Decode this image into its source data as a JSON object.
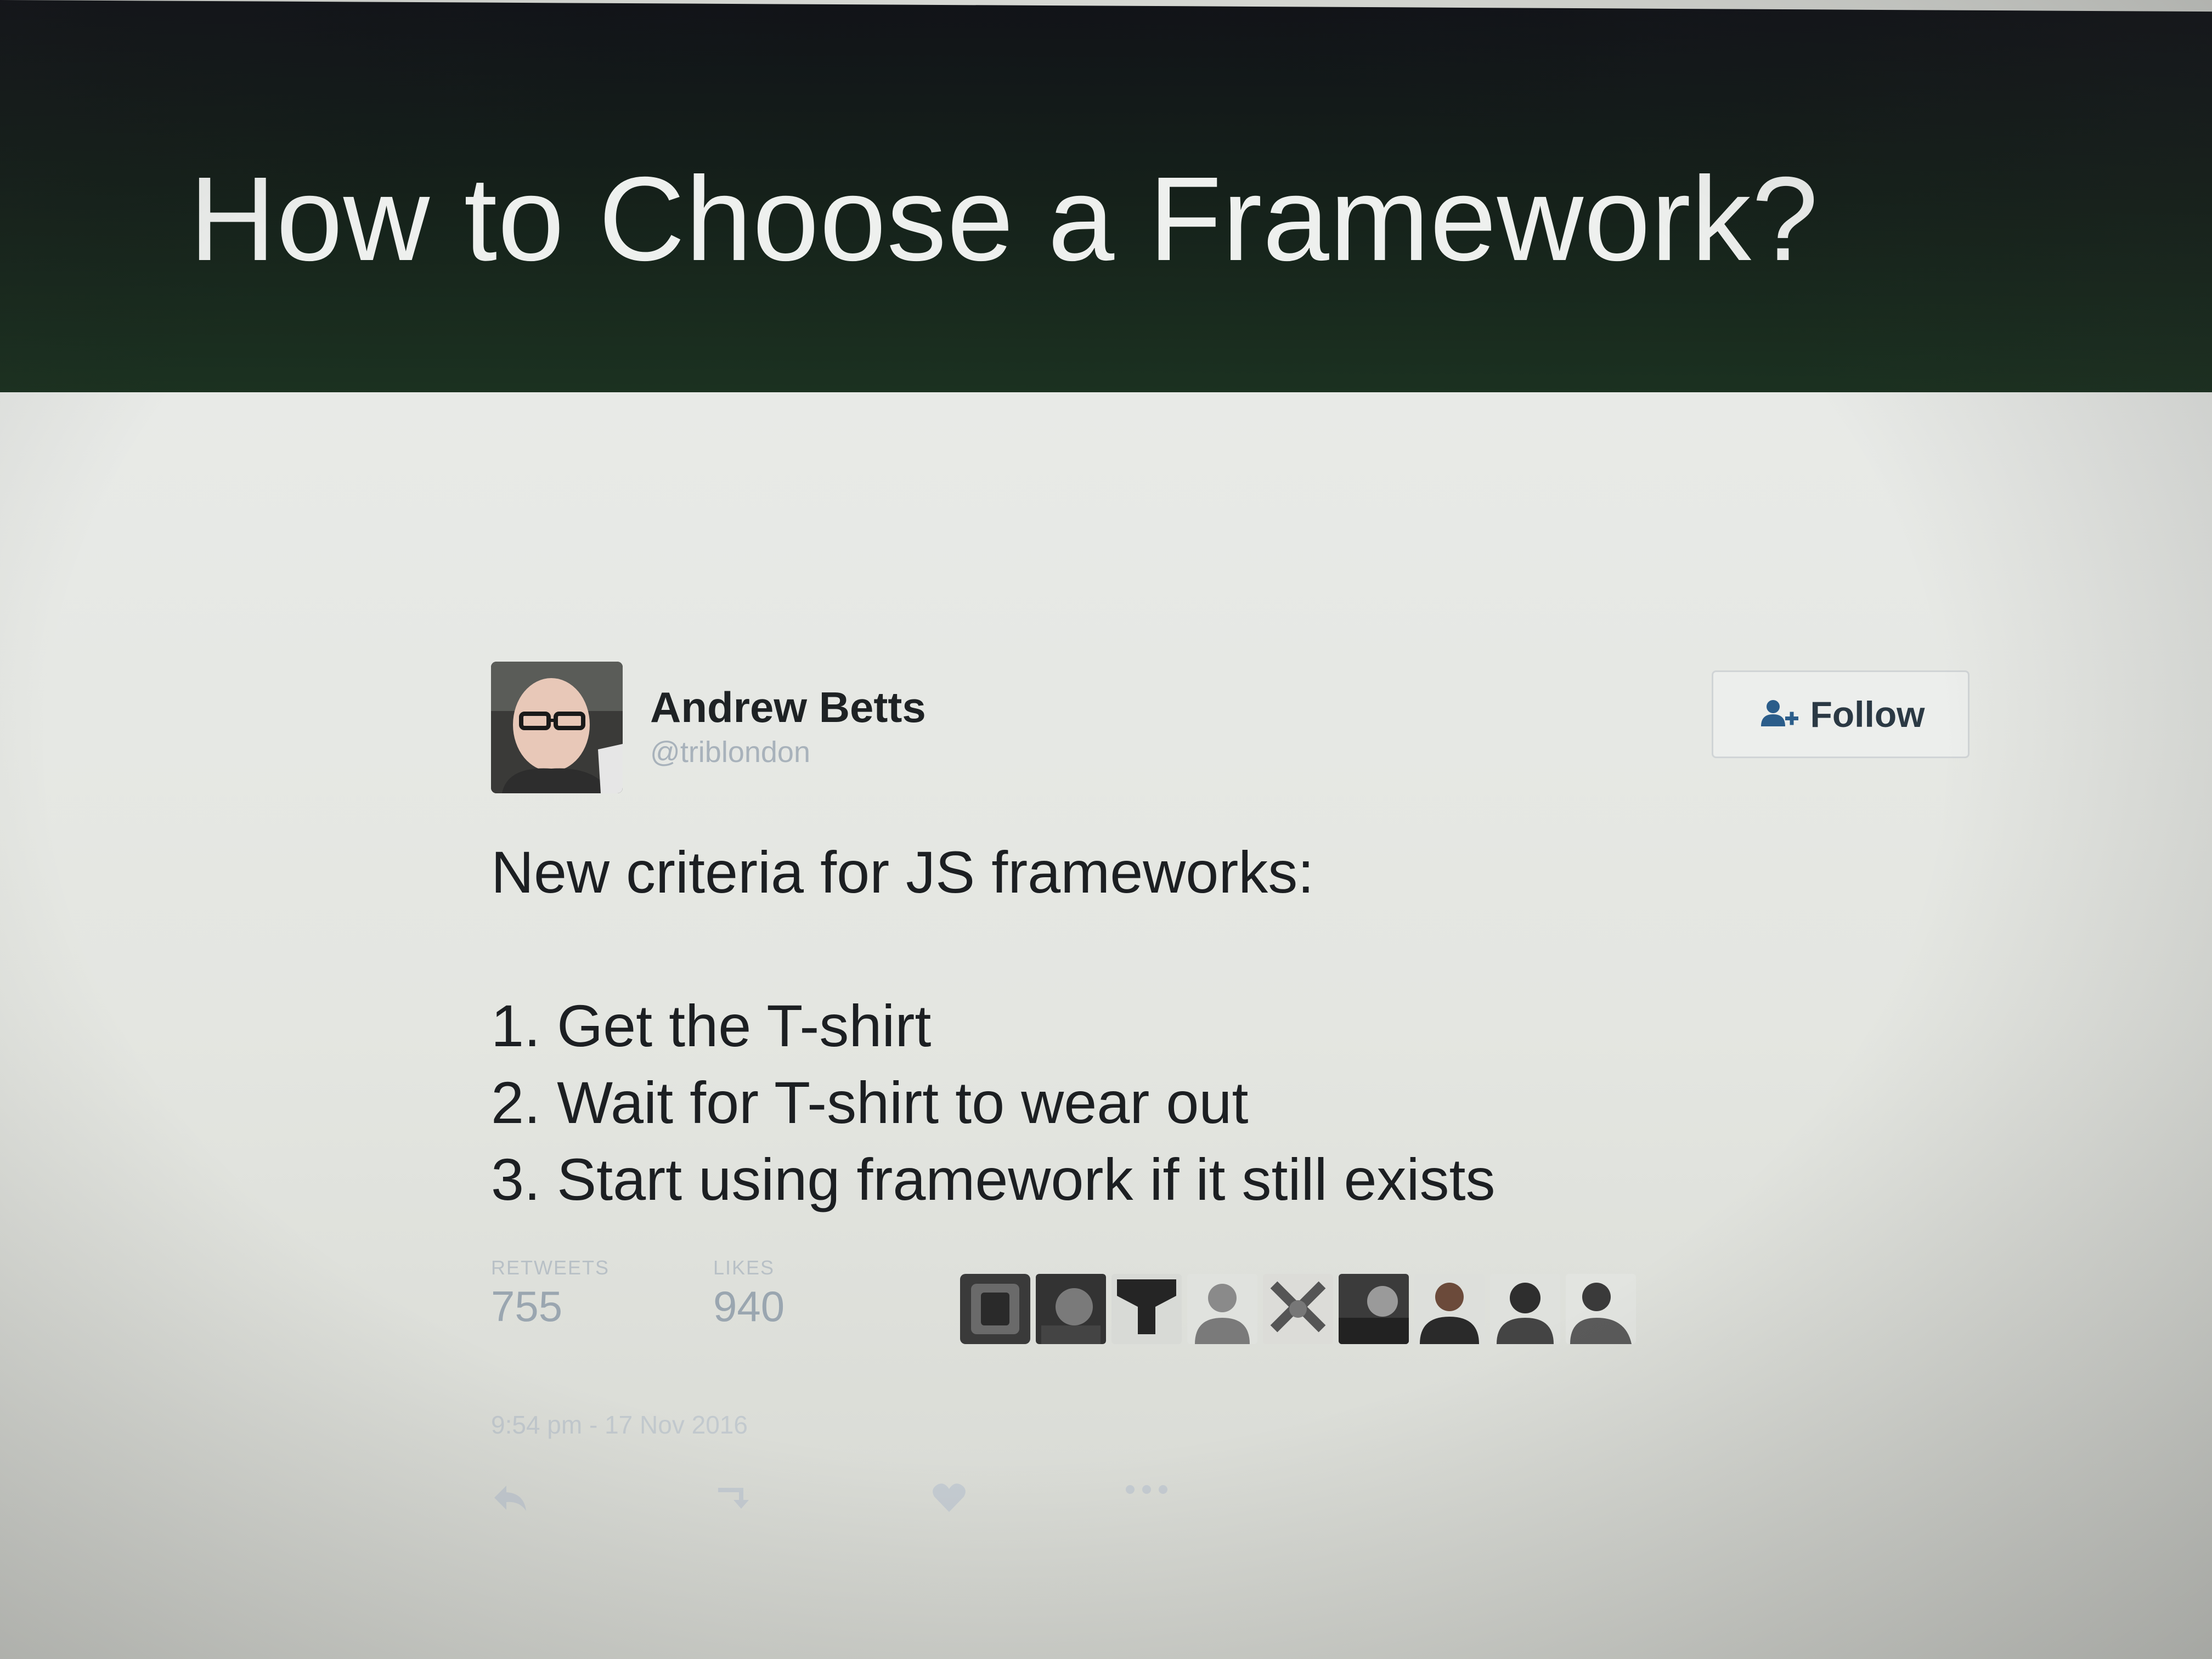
{
  "slide": {
    "title": "How to Choose a Framework?"
  },
  "tweet": {
    "author_name": "Andrew Betts",
    "author_handle": "@triblondon",
    "follow_label": "Follow",
    "text_lines": [
      "New criteria for JS frameworks:",
      "",
      "1. Get the T-shirt",
      "2. Wait for T-shirt to wear out",
      "3. Start using framework if it still exists"
    ],
    "stats": {
      "retweets_label": "RETWEETS",
      "retweets_value": "755",
      "likes_label": "LIKES",
      "likes_value": "940"
    },
    "liker_avatars": [
      "avatar-1",
      "avatar-2",
      "avatar-3",
      "avatar-4",
      "avatar-5",
      "avatar-6",
      "avatar-7",
      "avatar-8",
      "avatar-9"
    ],
    "timestamp": "9:54 pm - 17 Nov 2016",
    "actions": [
      {
        "icon": "reply-icon",
        "count": ""
      },
      {
        "icon": "retweet-icon",
        "count": ""
      },
      {
        "icon": "like-icon",
        "count": ""
      },
      {
        "icon": "more-icon",
        "count": ""
      }
    ]
  },
  "colors": {
    "header_dark": "#111318",
    "header_green": "#1c3321",
    "body_bg": "#e4e6e1",
    "text_dark": "#1c1f22",
    "muted": "#a8b2bb"
  }
}
